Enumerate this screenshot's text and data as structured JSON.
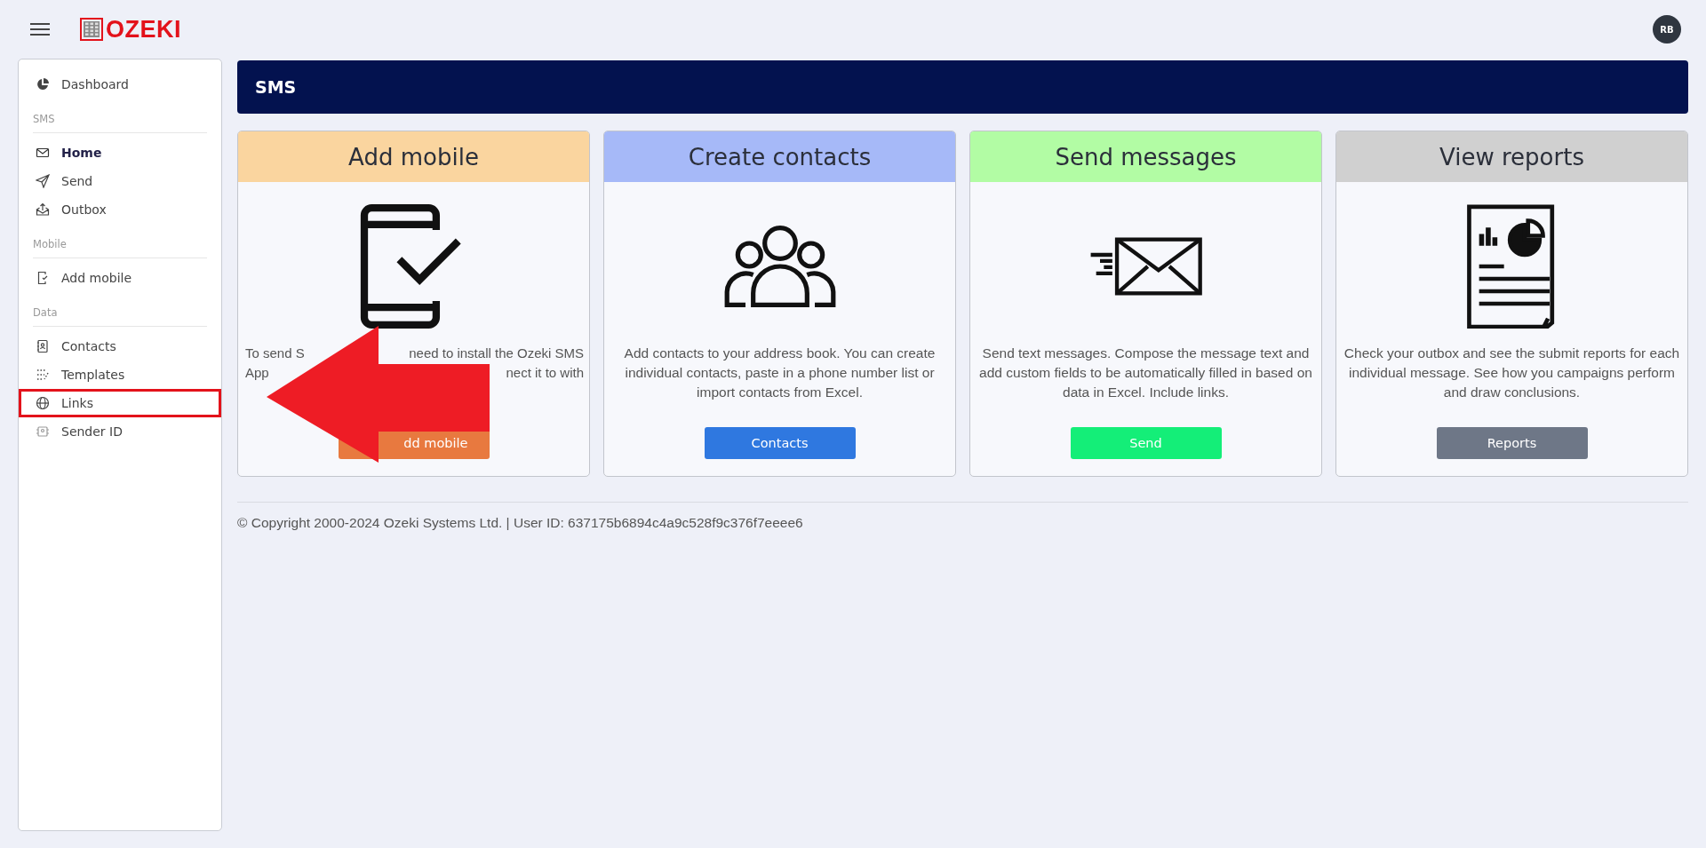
{
  "topbar": {
    "logo": "OZEKI",
    "avatar": "RB"
  },
  "sidebar": {
    "items": [
      {
        "kind": "link",
        "label": "Dashboard",
        "selected": false,
        "highlighted": false
      },
      {
        "kind": "section",
        "label": "SMS"
      },
      {
        "kind": "link",
        "label": "Home",
        "selected": true,
        "highlighted": false
      },
      {
        "kind": "link",
        "label": "Send",
        "selected": false,
        "highlighted": false
      },
      {
        "kind": "link",
        "label": "Outbox",
        "selected": false,
        "highlighted": false
      },
      {
        "kind": "section",
        "label": "Mobile"
      },
      {
        "kind": "link",
        "label": "Add mobile",
        "selected": false,
        "highlighted": false
      },
      {
        "kind": "section",
        "label": "Data"
      },
      {
        "kind": "link",
        "label": "Contacts",
        "selected": false,
        "highlighted": false
      },
      {
        "kind": "link",
        "label": "Templates",
        "selected": false,
        "highlighted": false
      },
      {
        "kind": "link",
        "label": "Links",
        "selected": false,
        "highlighted": true
      },
      {
        "kind": "link",
        "label": "Sender ID",
        "selected": false,
        "highlighted": false
      }
    ]
  },
  "header": {
    "title": "SMS"
  },
  "cards": [
    {
      "title": "Add mobile",
      "color": "#fad59f",
      "desc_lines": [
        [
          "To send S",
          "need to install the Ozeki SMS"
        ],
        [
          "App",
          "nect it to with"
        ]
      ],
      "button": "dd mobile"
    },
    {
      "title": "Create contacts",
      "color": "#a6b9f8",
      "description": "Add contacts to your address book. You can create individual contacts, paste in a phone number list or import contacts from Excel.",
      "button": "Contacts"
    },
    {
      "title": "Send messages",
      "color": "#b2fca4",
      "description": "Send text messages. Compose the message text and add custom fields to be automatically filled in based on data in Excel. Include links.",
      "button": "Send"
    },
    {
      "title": "View reports",
      "color": "#d0d0d0",
      "description": "Check your outbox and see the submit reports for each individual message. See how you campaigns perform and draw conclusions.",
      "button": "Reports"
    }
  ],
  "footer": {
    "text": "© Copyright 2000-2024 Ozeki Systems Ltd. | User ID: 637175b6894c4a9c528f9c376f7eeee6"
  },
  "annotations": [
    {
      "kind": "arrow"
    }
  ]
}
